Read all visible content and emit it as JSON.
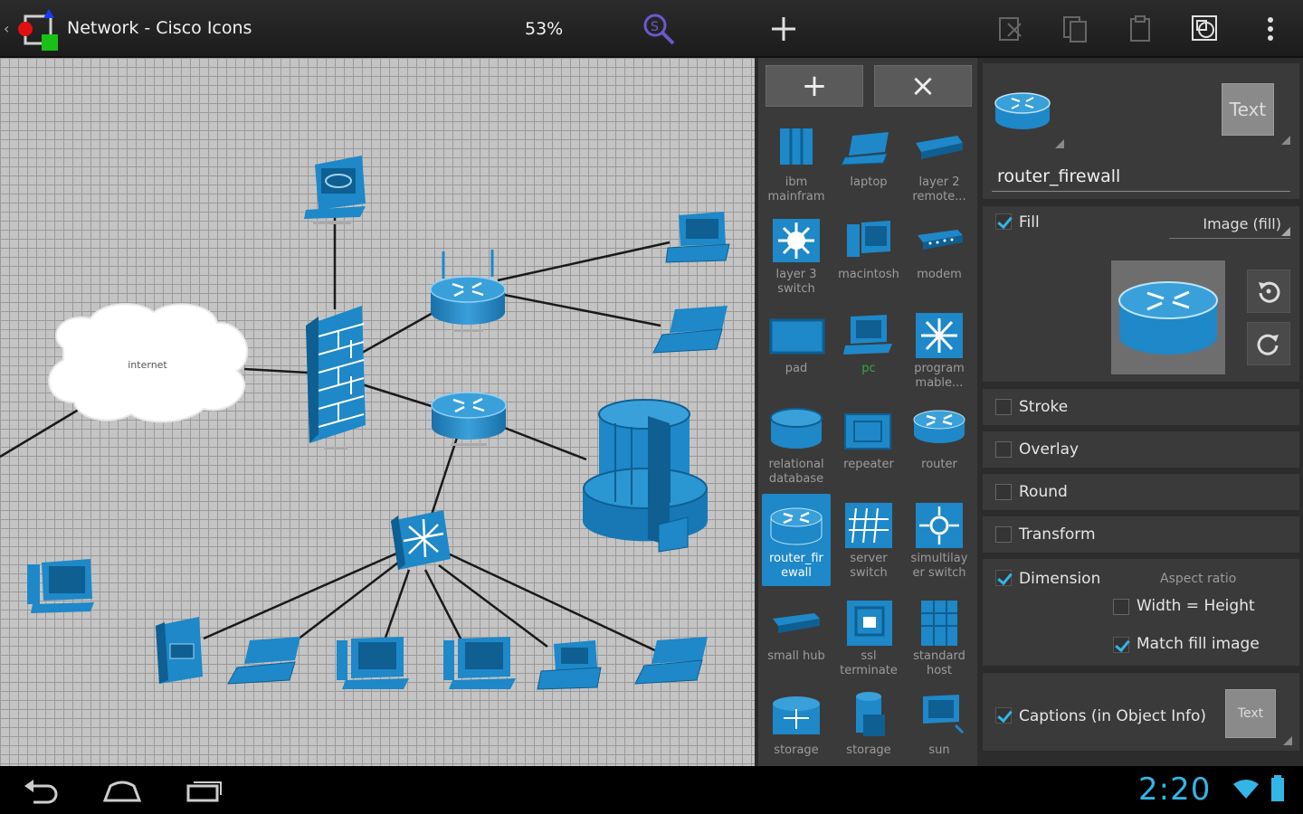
{
  "app": {
    "title": "Network - Cisco Icons",
    "zoom": "53%"
  },
  "toolbar": [
    {
      "name": "search-zoom-icon"
    },
    {
      "name": "add-icon"
    },
    {
      "name": "cut-icon"
    },
    {
      "name": "copy-icon"
    },
    {
      "name": "paste-icon"
    },
    {
      "name": "select-icon"
    },
    {
      "name": "overflow-menu-icon"
    }
  ],
  "canvas": {
    "nodes": [
      "internet",
      "web server",
      "firewall",
      "top router",
      "mid router",
      "multilayer switch",
      "mainframe",
      "laptop",
      "workstation",
      "pc"
    ],
    "labels": {
      "internet": "internet"
    }
  },
  "library": {
    "add_label": "+",
    "close_label": "×",
    "items": [
      {
        "label": "ibm mainfram",
        "icon": "mainframe-icon"
      },
      {
        "label": "laptop",
        "icon": "laptop-icon"
      },
      {
        "label": "layer 2 remote...",
        "icon": "layer2-remote-icon"
      },
      {
        "label": "layer 3 switch",
        "icon": "layer3-switch-icon"
      },
      {
        "label": "macintosh",
        "icon": "macintosh-icon"
      },
      {
        "label": "modem",
        "icon": "modem-icon"
      },
      {
        "label": "pad",
        "icon": "pad-icon"
      },
      {
        "label": "pc",
        "icon": "pc-icon"
      },
      {
        "label": "program mable...",
        "icon": "programmable-switch-icon"
      },
      {
        "label": "relational database",
        "icon": "database-icon"
      },
      {
        "label": "repeater",
        "icon": "repeater-icon"
      },
      {
        "label": "router",
        "icon": "router-icon"
      },
      {
        "label": "router_fir ewall",
        "icon": "router-firewall-icon"
      },
      {
        "label": "server switch",
        "icon": "server-switch-icon"
      },
      {
        "label": "simultilay er switch",
        "icon": "multilayer-switch-icon"
      },
      {
        "label": "small hub",
        "icon": "small-hub-icon"
      },
      {
        "label": "ssl terminate",
        "icon": "ssl-terminate-icon"
      },
      {
        "label": "standard host",
        "icon": "standard-host-icon"
      },
      {
        "label": "storage",
        "icon": "storage-router-icon"
      },
      {
        "label": "storage",
        "icon": "storage-server-icon"
      },
      {
        "label": "sun",
        "icon": "sun-workstation-icon"
      }
    ]
  },
  "props": {
    "text_button": "Text",
    "name_value": "router_firewall",
    "fill_label": "Fill",
    "fill_mode": "Image (fill)",
    "stroke_label": "Stroke",
    "overlay_label": "Overlay",
    "round_label": "Round",
    "transform_label": "Transform",
    "dimension_label": "Dimension",
    "aspect_ratio_label": "Aspect ratio",
    "width_height_label": "Width = Height",
    "match_fill_label": "Match fill image",
    "captions_label": "Captions (in Object Info)",
    "captions_text_button": "Text",
    "checks": {
      "fill": true,
      "stroke": false,
      "overlay": false,
      "round": false,
      "transform": false,
      "dimension": true,
      "width_height": false,
      "match_fill": true,
      "captions": true
    }
  },
  "system": {
    "clock": "2:20"
  },
  "colors": {
    "accent": "#33b5e5",
    "icon_blue": "#1e88c8",
    "canvas_bg": "#c4c4c4",
    "panel_bg": "#3a3a3a"
  }
}
